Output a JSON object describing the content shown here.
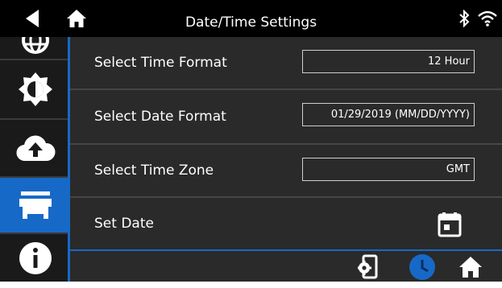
{
  "header": {
    "title": "Date/Time Settings",
    "icons": [
      "back-icon",
      "home-icon",
      "bluetooth-icon",
      "wifi-icon"
    ]
  },
  "sidebar": {
    "items": [
      {
        "name": "globe-icon",
        "selected": false
      },
      {
        "name": "brightness-icon",
        "selected": false
      },
      {
        "name": "cloud-upload-icon",
        "selected": false
      },
      {
        "name": "store-icon",
        "selected": true
      },
      {
        "name": "info-icon",
        "selected": false
      }
    ]
  },
  "settings": {
    "time_format": {
      "label": "Select Time Format",
      "value": "12 Hour"
    },
    "date_format": {
      "label": "Select Date Format",
      "value": "01/29/2019 (MM/DD/YYYY)"
    },
    "time_zone": {
      "label": "Select Time Zone",
      "value": "GMT"
    },
    "set_date": {
      "label": "Set Date",
      "icon": "calendar-icon"
    }
  },
  "bottom_bar": {
    "icons": [
      "device-settings-icon",
      "clock-icon",
      "home-icon"
    ]
  },
  "colors": {
    "accent": "#1769c7",
    "background": "#2a2a2a",
    "topbar": "#000000",
    "text": "#ffffff"
  }
}
